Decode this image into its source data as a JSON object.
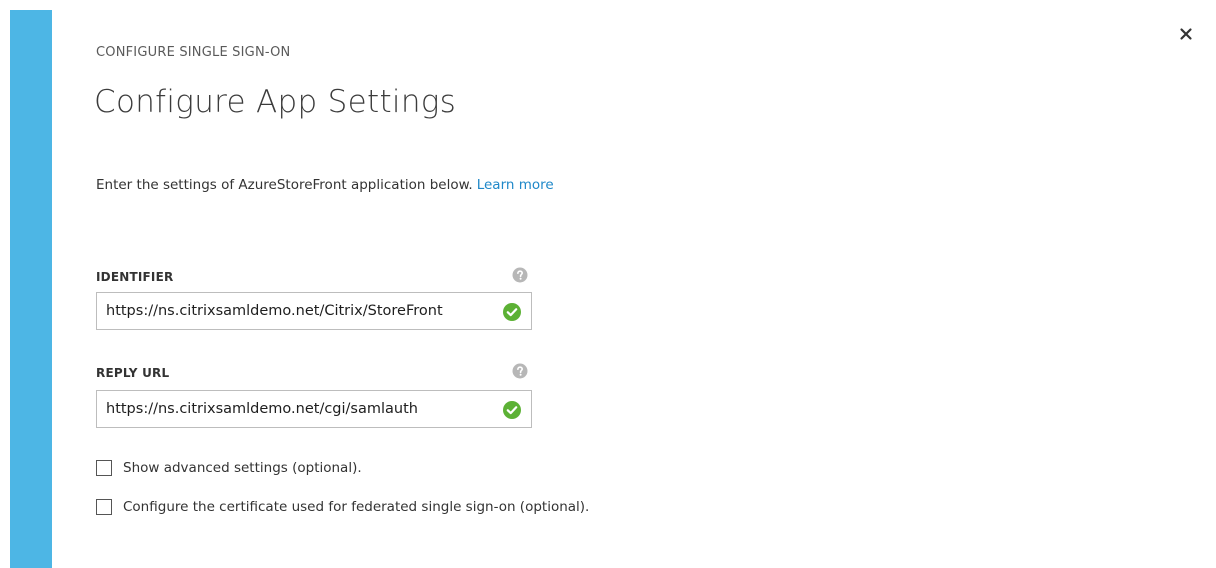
{
  "panel": {
    "subtitle": "CONFIGURE SINGLE SIGN-ON",
    "title": "Configure App Settings",
    "close_icon": "close-icon",
    "accent_color": "#4db6e5"
  },
  "intro": {
    "text": "Enter the settings of AzureStoreFront application below.",
    "link_label": "Learn more"
  },
  "fields": {
    "identifier": {
      "label": "IDENTIFIER",
      "value": "https://ns.citrixsamldemo.net/Citrix/StoreFront",
      "help_icon": "help-icon",
      "status_icon": "valid-check-icon"
    },
    "reply_url": {
      "label": "REPLY URL",
      "value": "https://ns.citrixsamldemo.net/cgi/samlauth",
      "help_icon": "help-icon",
      "status_icon": "valid-check-icon"
    }
  },
  "options": {
    "advanced": {
      "label": "Show advanced settings (optional).",
      "checked": false
    },
    "certificate": {
      "label": "Configure the certificate used for federated single sign-on (optional).",
      "checked": false
    }
  },
  "colors": {
    "link": "#1f88c9",
    "valid": "#5cb135",
    "help": "#b7b7b7"
  }
}
